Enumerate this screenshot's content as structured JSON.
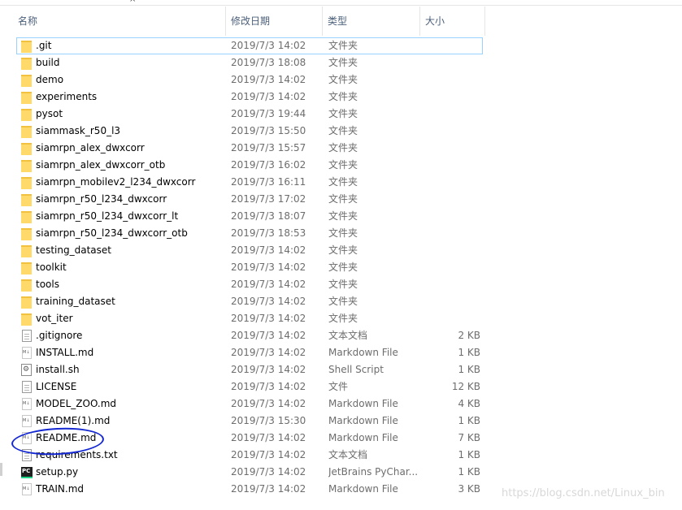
{
  "columns": {
    "name": "名称",
    "date": "修改日期",
    "type": "类型",
    "size": "大小"
  },
  "sort_indicator": "^",
  "files": [
    {
      "name": ".git",
      "date": "2019/7/3 14:02",
      "type": "文件夹",
      "size": "",
      "icon": "folder-icon"
    },
    {
      "name": "build",
      "date": "2019/7/3 18:08",
      "type": "文件夹",
      "size": "",
      "icon": "folder-icon"
    },
    {
      "name": "demo",
      "date": "2019/7/3 14:02",
      "type": "文件夹",
      "size": "",
      "icon": "folder-icon"
    },
    {
      "name": "experiments",
      "date": "2019/7/3 14:02",
      "type": "文件夹",
      "size": "",
      "icon": "folder-icon"
    },
    {
      "name": "pysot",
      "date": "2019/7/3 19:44",
      "type": "文件夹",
      "size": "",
      "icon": "folder-icon"
    },
    {
      "name": "siammask_r50_l3",
      "date": "2019/7/3 15:50",
      "type": "文件夹",
      "size": "",
      "icon": "folder-icon"
    },
    {
      "name": "siamrpn_alex_dwxcorr",
      "date": "2019/7/3 15:57",
      "type": "文件夹",
      "size": "",
      "icon": "folder-icon"
    },
    {
      "name": "siamrpn_alex_dwxcorr_otb",
      "date": "2019/7/3 16:02",
      "type": "文件夹",
      "size": "",
      "icon": "folder-icon"
    },
    {
      "name": "siamrpn_mobilev2_l234_dwxcorr",
      "date": "2019/7/3 16:11",
      "type": "文件夹",
      "size": "",
      "icon": "folder-icon"
    },
    {
      "name": "siamrpn_r50_l234_dwxcorr",
      "date": "2019/7/3 17:02",
      "type": "文件夹",
      "size": "",
      "icon": "folder-icon"
    },
    {
      "name": "siamrpn_r50_l234_dwxcorr_lt",
      "date": "2019/7/3 18:07",
      "type": "文件夹",
      "size": "",
      "icon": "folder-icon"
    },
    {
      "name": "siamrpn_r50_l234_dwxcorr_otb",
      "date": "2019/7/3 18:53",
      "type": "文件夹",
      "size": "",
      "icon": "folder-icon"
    },
    {
      "name": "testing_dataset",
      "date": "2019/7/3 14:02",
      "type": "文件夹",
      "size": "",
      "icon": "folder-icon"
    },
    {
      "name": "toolkit",
      "date": "2019/7/3 14:02",
      "type": "文件夹",
      "size": "",
      "icon": "folder-icon"
    },
    {
      "name": "tools",
      "date": "2019/7/3 14:02",
      "type": "文件夹",
      "size": "",
      "icon": "folder-icon"
    },
    {
      "name": "training_dataset",
      "date": "2019/7/3 14:02",
      "type": "文件夹",
      "size": "",
      "icon": "folder-icon"
    },
    {
      "name": "vot_iter",
      "date": "2019/7/3 14:02",
      "type": "文件夹",
      "size": "",
      "icon": "folder-icon"
    },
    {
      "name": ".gitignore",
      "date": "2019/7/3 14:02",
      "type": "文本文档",
      "size": "2 KB",
      "icon": "text-file-icon"
    },
    {
      "name": "INSTALL.md",
      "date": "2019/7/3 14:02",
      "type": "Markdown File",
      "size": "1 KB",
      "icon": "markdown-file-icon"
    },
    {
      "name": "install.sh",
      "date": "2019/7/3 14:02",
      "type": "Shell Script",
      "size": "1 KB",
      "icon": "shell-script-icon"
    },
    {
      "name": "LICENSE",
      "date": "2019/7/3 14:02",
      "type": "文件",
      "size": "12 KB",
      "icon": "blank-file-icon"
    },
    {
      "name": "MODEL_ZOO.md",
      "date": "2019/7/3 14:02",
      "type": "Markdown File",
      "size": "4 KB",
      "icon": "markdown-file-icon"
    },
    {
      "name": "README(1).md",
      "date": "2019/7/3 15:30",
      "type": "Markdown File",
      "size": "1 KB",
      "icon": "markdown-file-icon"
    },
    {
      "name": "README.md",
      "date": "2019/7/3 14:02",
      "type": "Markdown File",
      "size": "7 KB",
      "icon": "markdown-file-icon"
    },
    {
      "name": "requirements.txt",
      "date": "2019/7/3 14:02",
      "type": "文本文档",
      "size": "1 KB",
      "icon": "text-file-icon"
    },
    {
      "name": "setup.py",
      "date": "2019/7/3 14:02",
      "type": "JetBrains PyChar...",
      "size": "1 KB",
      "icon": "pycharm-file-icon"
    },
    {
      "name": "TRAIN.md",
      "date": "2019/7/3 14:02",
      "type": "Markdown File",
      "size": "3 KB",
      "icon": "markdown-file-icon"
    }
  ],
  "annotation": {
    "highlighted_file": "README.md",
    "circle_color": "#1428d2"
  },
  "watermark": "https://blog.csdn.net/Linux_bin"
}
